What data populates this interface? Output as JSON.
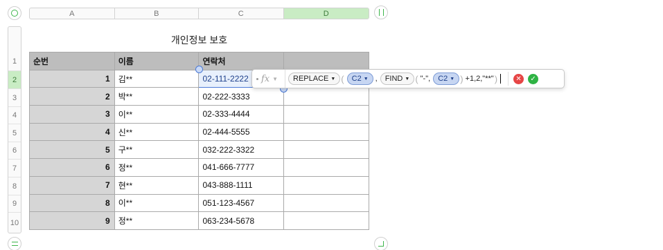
{
  "columns": [
    {
      "label": "A",
      "selected": false
    },
    {
      "label": "B",
      "selected": false
    },
    {
      "label": "C",
      "selected": false
    },
    {
      "label": "D",
      "selected": true
    }
  ],
  "rows": [
    "1",
    "2",
    "3",
    "4",
    "5",
    "6",
    "7",
    "8",
    "9",
    "10"
  ],
  "selected_row": "2",
  "title": "개인정보 보호",
  "table": {
    "headers": [
      "순번",
      "이름",
      "연락처",
      ""
    ],
    "rows": [
      [
        "1",
        "김**",
        "02-111-2222"
      ],
      [
        "2",
        "박**",
        "02-222-3333"
      ],
      [
        "3",
        "이**",
        "02-333-4444"
      ],
      [
        "4",
        "신**",
        "02-444-5555"
      ],
      [
        "5",
        "구**",
        "032-222-3322"
      ],
      [
        "6",
        "정**",
        "041-666-7777"
      ],
      [
        "7",
        "현**",
        "043-888-1111"
      ],
      [
        "8",
        "이**",
        "051-123-4567"
      ],
      [
        "9",
        "정**",
        "063-234-5678"
      ]
    ]
  },
  "formula": {
    "fx_label": "fx",
    "fn1": "REPLACE",
    "ref1": "C2",
    "sep1": ",",
    "fn2": "FIND",
    "str1": "\"-\",",
    "ref2": "C2",
    "tail": "+1,2,\"**\""
  },
  "colors": {
    "selection": "#4a79d6",
    "accent_green": "#3cb54a",
    "cancel": "#e64545",
    "confirm": "#2fb344"
  },
  "icons": [
    "cancel-icon",
    "confirm-icon",
    "dropdown-triangle-icon"
  ]
}
